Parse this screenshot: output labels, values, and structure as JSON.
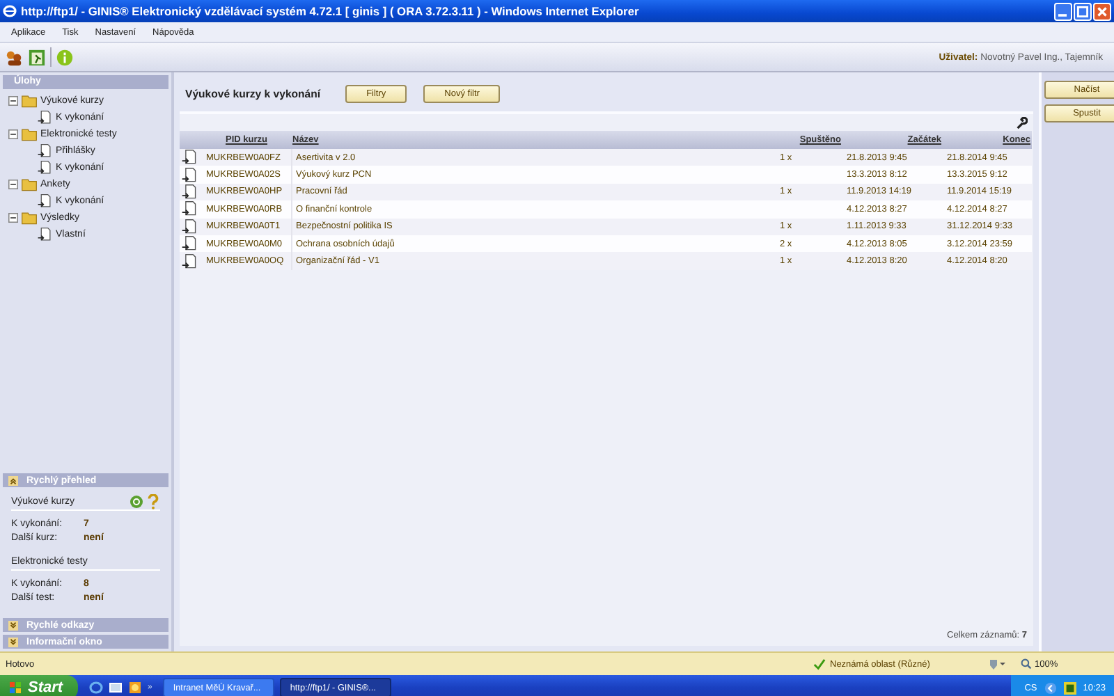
{
  "window": {
    "title": "http://ftp1/ - GINIS® Elektronický vzdělávací systém 4.72.1 [ ginis ] ( ORA 3.72.3.11 ) - Windows Internet Explorer"
  },
  "menu": [
    "Aplikace",
    "Tisk",
    "Nastavení",
    "Nápověda"
  ],
  "user": "**Uživatel:** Novotný Pavel Ing., Tajemník",
  "sidebar": {
    "title": "Úlohy",
    "tree": [
      {
        "label": "Výukové kurzy",
        "expanded": true,
        "children": [
          {
            "label": "K vykonání"
          }
        ]
      },
      {
        "label": "Elektronické testy",
        "expanded": true,
        "children": [
          {
            "label": "Přihlášky"
          },
          {
            "label": "K vykonání"
          }
        ]
      },
      {
        "label": "Ankety",
        "expanded": true,
        "children": [
          {
            "label": "K vykonání"
          }
        ]
      },
      {
        "label": "Výsledky",
        "expanded": true,
        "children": [
          {
            "label": "Vlastní"
          }
        ]
      }
    ]
  },
  "panels": [
    {
      "title": "Rychlý přehled",
      "expanded": true,
      "groups": [
        {
          "title": "Výukové kurzy",
          "rows": [
            {
              "label": "K vykonání:",
              "value": "7"
            },
            {
              "label": "Další kurz:",
              "value": "není"
            }
          ]
        },
        {
          "title": "Elektronické testy",
          "rows": [
            {
              "label": "K vykonání:",
              "value": "8"
            },
            {
              "label": "Další test:",
              "value": "není"
            }
          ]
        }
      ]
    },
    {
      "title": "Rychlé odkazy",
      "expanded": false
    },
    {
      "title": "Informační okno",
      "expanded": false
    }
  ],
  "content": {
    "title": "Výukové kurzy k vykonání",
    "buttons": [
      "Filtry",
      "Nový filtr"
    ],
    "table": {
      "columns": [
        "PID kurzu",
        "Název",
        "Spuštěno",
        "Začátek",
        "Konec"
      ],
      "rows": [
        {
          "pid": "MUKRBEW0A0FZ",
          "name": "Asertivita v 2.0",
          "launched": "1 x",
          "start": "21.8.2013 9:45",
          "end": "21.8.2014 9:45"
        },
        {
          "pid": "MUKRBEW0A02S",
          "name": "Výukový kurz PCN",
          "start": "13.3.2013 8:12",
          "end": "13.3.2015 9:12"
        },
        {
          "pid": "MUKRBEW0A0HP",
          "name": "Pracovní řád",
          "launched": "1 x",
          "start": "11.9.2013 14:19",
          "end": "11.9.2014 15:19"
        },
        {
          "pid": "MUKRBEW0A0RB",
          "name": "O finanční kontrole",
          "start": "4.12.2013 8:27",
          "end": "4.12.2014 8:27"
        },
        {
          "pid": "MUKRBEW0A0T1",
          "name": "Bezpečnostní politika IS",
          "launched": "1 x",
          "start": "1.11.2013 9:33",
          "end": "31.12.2014 9:33"
        },
        {
          "pid": "MUKRBEW0A0M0",
          "name": "Ochrana osobních údajů",
          "launched": "2 x",
          "start": "4.12.2013 8:05",
          "end": "3.12.2014 23:59"
        },
        {
          "pid": "MUKRBEW0A0OQ",
          "name": "Organizační řád - V1",
          "launched": "1 x",
          "start": "4.12.2013 8:20",
          "end": "4.12.2014 8:20"
        }
      ]
    },
    "total": "Celkem záznamů: **7**"
  },
  "side_buttons": [
    "Načíst",
    "Spustit"
  ],
  "status_bar": {
    "text": "Hotovo",
    "zone": "Neznámá oblast (Různé)",
    "zoom": "100%"
  },
  "taskbar": {
    "start": "Start",
    "more": "»",
    "tasks": [
      {
        "label": "Intranet MěÚ Kravař...",
        "selected": false
      },
      {
        "label": "http://ftp1/ - GINIS®...",
        "selected": true
      }
    ],
    "language": "CS",
    "clock": "10:23"
  }
}
